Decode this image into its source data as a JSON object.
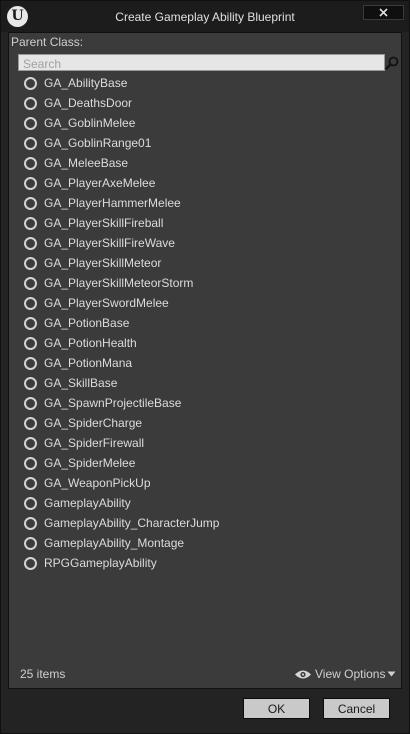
{
  "window": {
    "title": "Create Gameplay Ability Blueprint"
  },
  "panel": {
    "parent_class_label": "Parent Class:",
    "search": {
      "placeholder": "Search",
      "value": ""
    },
    "items": [
      {
        "label": "GA_AbilityBase"
      },
      {
        "label": "GA_DeathsDoor"
      },
      {
        "label": "GA_GoblinMelee"
      },
      {
        "label": "GA_GoblinRange01"
      },
      {
        "label": "GA_MeleeBase"
      },
      {
        "label": "GA_PlayerAxeMelee"
      },
      {
        "label": "GA_PlayerHammerMelee"
      },
      {
        "label": "GA_PlayerSkillFireball"
      },
      {
        "label": "GA_PlayerSkillFireWave"
      },
      {
        "label": "GA_PlayerSkillMeteor"
      },
      {
        "label": "GA_PlayerSkillMeteorStorm"
      },
      {
        "label": "GA_PlayerSwordMelee"
      },
      {
        "label": "GA_PotionBase"
      },
      {
        "label": "GA_PotionHealth"
      },
      {
        "label": "GA_PotionMana"
      },
      {
        "label": "GA_SkillBase"
      },
      {
        "label": "GA_SpawnProjectileBase"
      },
      {
        "label": "GA_SpiderCharge"
      },
      {
        "label": "GA_SpiderFirewall"
      },
      {
        "label": "GA_SpiderMelee"
      },
      {
        "label": "GA_WeaponPickUp"
      },
      {
        "label": "GameplayAbility"
      },
      {
        "label": "GameplayAbility_CharacterJump"
      },
      {
        "label": "GameplayAbility_Montage"
      },
      {
        "label": "RPGGameplayAbility"
      }
    ],
    "item_count": "25 items",
    "view_options_label": "View Options"
  },
  "footer": {
    "ok_label": "OK",
    "cancel_label": "Cancel"
  },
  "icons": {
    "logo": "unreal-logo-icon",
    "close": "close-icon",
    "search": "search-icon",
    "eye": "eye-icon",
    "caret": "caret-down-icon",
    "radio": "radio-unselected-icon"
  },
  "colors": {
    "window_bg": "#232323",
    "panel_bg": "#3b3b3b",
    "button_bg": "#c9c9c9"
  }
}
